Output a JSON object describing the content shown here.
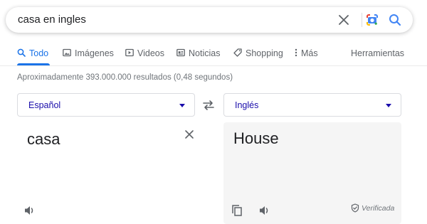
{
  "search": {
    "query": "casa en ingles",
    "clear_icon": "close-icon",
    "lens_icon": "google-lens-icon",
    "search_icon": "search-icon"
  },
  "tabs": [
    {
      "label": "Todo",
      "icon": "search-icon",
      "active": true
    },
    {
      "label": "Imágenes",
      "icon": "image-icon"
    },
    {
      "label": "Videos",
      "icon": "play-icon"
    },
    {
      "label": "Noticias",
      "icon": "news-icon"
    },
    {
      "label": "Shopping",
      "icon": "tag-icon"
    },
    {
      "label": "Más",
      "icon": "more-vert-icon"
    }
  ],
  "tools_label": "Herramientas",
  "results_stats": "Aproximadamente 393.000.000 resultados (0,48 segundos)",
  "translator": {
    "source_lang": "Español",
    "target_lang": "Inglés",
    "source_text": "casa",
    "target_text": "House",
    "verified_label": "Verificada"
  },
  "colors": {
    "accent": "#1a73e8",
    "link": "#1a0dab",
    "muted": "#70757a",
    "panel_bg": "#f5f5f5"
  }
}
